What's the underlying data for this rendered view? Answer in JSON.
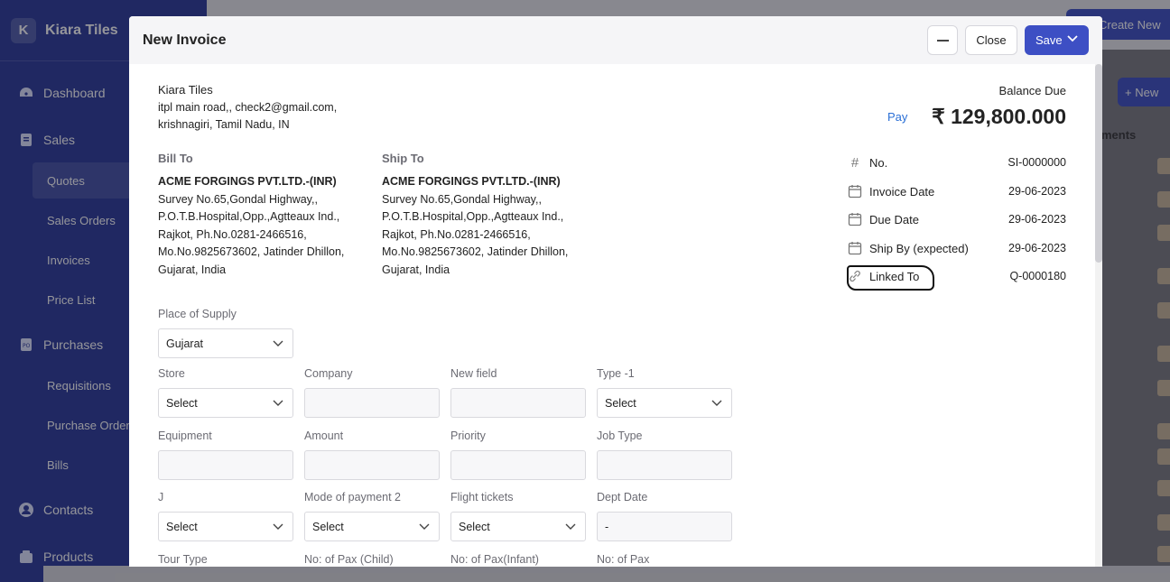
{
  "sidebar": {
    "brand_letter": "K",
    "brand_name": "Kiara Tiles",
    "items": [
      {
        "label": "Dashboard"
      },
      {
        "label": "Sales"
      },
      {
        "label": "Quotes"
      },
      {
        "label": "Sales Orders"
      },
      {
        "label": "Invoices"
      },
      {
        "label": "Price List"
      },
      {
        "label": "Purchases"
      },
      {
        "label": "Requisitions"
      },
      {
        "label": "Purchase Orders"
      },
      {
        "label": "Bills"
      },
      {
        "label": "Contacts"
      },
      {
        "label": "Products"
      }
    ]
  },
  "background": {
    "create_new": "Create New",
    "new_button": "+ New",
    "column_header": "ments"
  },
  "modal": {
    "title": "New Invoice",
    "close_label": "Close",
    "save_label": "Save",
    "company": {
      "name": "Kiara Tiles",
      "line1": "itpl main road,, check2@gmail.com,",
      "line2": "krishnagiri, Tamil Nadu, IN"
    },
    "bill_to": {
      "label": "Bill To",
      "name": "ACME FORGINGS PVT.LTD.-(INR)",
      "lines": [
        "Survey No.65,Gondal Highway,,",
        "P.O.T.B.Hospital,Opp.,Agtteaux Ind.,",
        "Rajkot, Ph.No.0281-2466516,",
        "Mo.No.9825673602, Jatinder Dhillon,",
        "Gujarat, India"
      ]
    },
    "ship_to": {
      "label": "Ship To",
      "name": "ACME FORGINGS PVT.LTD.-(INR)",
      "lines": [
        "Survey No.65,Gondal Highway,,",
        "P.O.T.B.Hospital,Opp.,Agtteaux Ind.,",
        "Rajkot, Ph.No.0281-2466516,",
        "Mo.No.9825673602, Jatinder Dhillon,",
        "Gujarat, India"
      ]
    },
    "balance": {
      "label": "Balance Due",
      "pay": "Pay",
      "amount": "₹ 129,800.000"
    },
    "meta": [
      {
        "icon": "hash-icon",
        "label": "No.",
        "value": "SI-0000000"
      },
      {
        "icon": "calendar-icon",
        "label": "Invoice Date",
        "value": "29-06-2023"
      },
      {
        "icon": "calendar-icon",
        "label": "Due Date",
        "value": "29-06-2023"
      },
      {
        "icon": "calendar-icon",
        "label": "Ship By (expected)",
        "value": "29-06-2023"
      },
      {
        "icon": "link-icon",
        "label": "Linked To",
        "value": "Q-0000180"
      }
    ],
    "place_of_supply": {
      "label": "Place of Supply",
      "value": "Gujarat"
    },
    "fields": [
      {
        "label": "Store",
        "value": "Select",
        "type": "select"
      },
      {
        "label": "Company",
        "value": "",
        "type": "text"
      },
      {
        "label": "New field",
        "value": "",
        "type": "text"
      },
      {
        "label": "Type -1",
        "value": "Select",
        "type": "select"
      },
      {
        "label": "Equipment",
        "value": "",
        "type": "text"
      },
      {
        "label": "Amount",
        "value": "",
        "type": "text"
      },
      {
        "label": "Priority",
        "value": "",
        "type": "text"
      },
      {
        "label": "Job Type",
        "value": "",
        "type": "text"
      },
      {
        "label": "J",
        "value": "Select",
        "type": "select"
      },
      {
        "label": "Mode of payment 2",
        "value": "Select",
        "type": "select"
      },
      {
        "label": "Flight tickets",
        "value": "Select",
        "type": "select"
      },
      {
        "label": "Dept Date",
        "value": "-",
        "type": "text"
      },
      {
        "label": "Tour Type",
        "value": "",
        "type": "text"
      },
      {
        "label": "No: of Pax (Child)",
        "value": "",
        "type": "text"
      },
      {
        "label": "No: of Pax(Infant)",
        "value": "",
        "type": "text"
      },
      {
        "label": "No: of Pax",
        "value": "",
        "type": "text"
      }
    ]
  },
  "colors": {
    "primary": "#3d4fc4",
    "sidebar": "#2b3a9a",
    "link": "#2a6fd6"
  }
}
